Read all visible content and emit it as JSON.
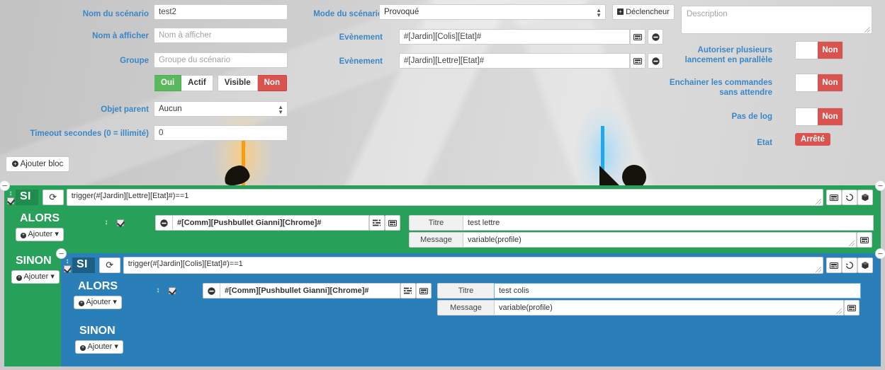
{
  "colors": {
    "label_blue": "#3a87c8",
    "green": "#27a05a",
    "green_dark": "#1f8b4d",
    "blue": "#2a7fb8",
    "blue_dark": "#1d5f82",
    "red": "#d9534f",
    "success_green": "#5cb85c"
  },
  "form": {
    "scenario_name": {
      "label": "Nom du scénario",
      "value": "test2"
    },
    "display_name": {
      "label": "Nom à afficher",
      "value": "",
      "placeholder": "Nom à afficher"
    },
    "group": {
      "label": "Groupe",
      "value": "",
      "placeholder": "Groupe du scénario"
    },
    "state_group": {
      "active_on": "Oui",
      "active_label": "Actif",
      "visible_label": "Visible",
      "visible_off": "Non"
    },
    "parent_object": {
      "label": "Objet parent",
      "value": "Aucun"
    },
    "timeout": {
      "label": "Timeout secondes (0 = illimité)",
      "value": "0"
    },
    "mode": {
      "label": "Mode du scénario",
      "value": "Provoqué"
    },
    "trigger_button": {
      "label": "Déclencheur",
      "icon": "plus-square-icon"
    },
    "events": [
      {
        "label": "Evènement",
        "value": "#[Jardin][Colis][Etat]#",
        "keyboard_icon": "keyboard-icon",
        "remove_icon": "minus-circle-icon"
      },
      {
        "label": "Evènement",
        "value": "#[Jardin][Lettre][Etat]#",
        "keyboard_icon": "keyboard-icon",
        "remove_icon": "minus-circle-icon"
      }
    ],
    "description": {
      "value": "",
      "placeholder": "Description"
    },
    "toggles": [
      {
        "label": "Autoriser plusieurs lancement en parallèle",
        "value": "Non"
      },
      {
        "label": "Enchainer les commandes sans attendre",
        "value": "Non"
      },
      {
        "label": "Pas de log",
        "value": "Non"
      }
    ],
    "state": {
      "label": "Etat",
      "value": "Arrêté"
    }
  },
  "toolbar": {
    "add_block_label": "Ajouter bloc",
    "add_block_icon": "plus-circle-icon"
  },
  "blocks": {
    "outer": {
      "si_label": "SI",
      "condition": "trigger(#[Jardin][Lettre][Etat]#)==1",
      "refresh_icon": "refresh-icon",
      "tools": [
        "keyboard-icon",
        "history-icon",
        "cube-icon"
      ],
      "alors": {
        "keyword": "ALORS",
        "add_label": "Ajouter",
        "command": "#[Comm][Pushbullet Gianni][Chrome]#",
        "command_icons": [
          "sliders-icon",
          "keyboard-icon"
        ],
        "fields": [
          {
            "key": "Titre",
            "value": "test lettre"
          },
          {
            "key": "Message",
            "value": "variable(profile)",
            "keyboard_icon": "keyboard-icon"
          }
        ]
      },
      "sinon": {
        "keyword": "SINON",
        "add_label": "Ajouter"
      }
    },
    "inner": {
      "si_label": "SI",
      "condition": "trigger(#[Jardin][Colis][Etat]#)==1",
      "refresh_icon": "refresh-icon",
      "tools": [
        "keyboard-icon",
        "history-icon",
        "cube-icon"
      ],
      "alors": {
        "keyword": "ALORS",
        "add_label": "Ajouter",
        "command": "#[Comm][Pushbullet Gianni][Chrome]#",
        "command_icons": [
          "sliders-icon",
          "keyboard-icon"
        ],
        "fields": [
          {
            "key": "Titre",
            "value": "test  colis"
          },
          {
            "key": "Message",
            "value": "variable(profile)",
            "keyboard_icon": "keyboard-icon"
          }
        ]
      },
      "sinon": {
        "keyword": "SINON",
        "add_label": "Ajouter"
      }
    }
  }
}
